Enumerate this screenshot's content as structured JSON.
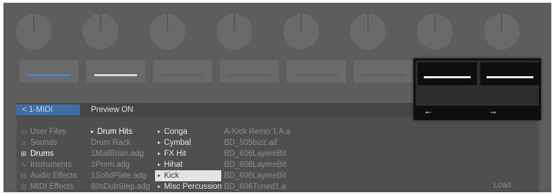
{
  "colors": {
    "device_bg": "#5d5d5d",
    "knob": "#6a6a6a",
    "display_bg": "#4f4f4f",
    "accent_blue": "#3e6ea3",
    "selected_bg": "#e4e4e4"
  },
  "display": {
    "back_label": "< 1-MIDI",
    "preview_label": "Preview ON",
    "load_label": "Load",
    "categories": [
      {
        "label": "User Files",
        "icon": "monitor-icon",
        "glyph": "▭"
      },
      {
        "label": "Sounds",
        "icon": "music-note-icon",
        "glyph": "♫"
      },
      {
        "label": "Drums",
        "icon": "grid-icon",
        "glyph": "⊞"
      },
      {
        "label": "Instruments",
        "icon": "wave-icon",
        "glyph": "∿"
      },
      {
        "label": "Audio Effects",
        "icon": "audio-fx-icon",
        "glyph": "⊟"
      },
      {
        "label": "MIDI Effects",
        "icon": "midi-fx-icon",
        "glyph": "⊡"
      }
    ],
    "selected_category": "Drums",
    "column2": [
      "Drum Hits",
      "Drum Rack",
      "1MailBrian.adg",
      "1Prem.adg",
      "1SolidPlate.adg",
      "80sDubStep.adg"
    ],
    "column3": [
      "Conga",
      "Cymbal",
      "FX Hit",
      "Hihat",
      "Kick",
      "Misc Percussion"
    ],
    "selected_item": "Kick",
    "column4": [
      "A-Kick Remo 1 A.a",
      "BD_505bizz.aif",
      "BD_606LayereBit",
      "BD_606LayereBit",
      "BD_606LayereBit",
      "BD_606Tuned1.a"
    ]
  },
  "popup": {
    "left_arrow": "←",
    "right_arrow": "→"
  }
}
